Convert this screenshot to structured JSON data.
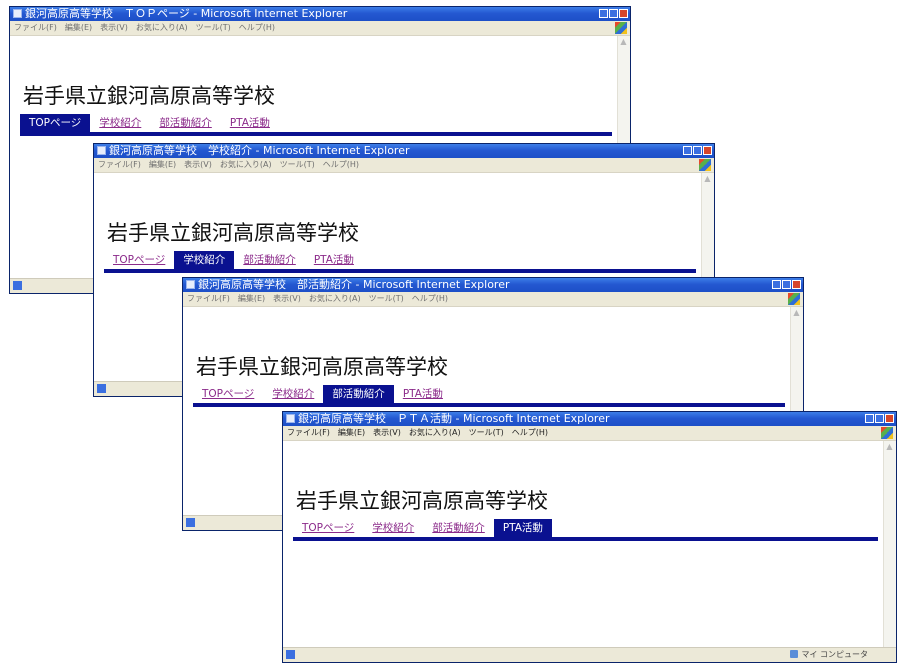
{
  "heading": "岩手県立銀河高原高等学校",
  "menu": [
    "ファイル(F)",
    "編集(E)",
    "表示(V)",
    "お気に入り(A)",
    "ツール(T)",
    "ヘルプ(H)"
  ],
  "nav": [
    "TOPページ",
    "学校紹介",
    "部活動紹介",
    "PTA活動"
  ],
  "windows": [
    {
      "title": "銀河高原高等学校　ＴＯＰページ - Microsoft Internet Explorer",
      "selected_index": 0
    },
    {
      "title": "銀河高原高等学校　学校紹介 - Microsoft Internet Explorer",
      "selected_index": 1
    },
    {
      "title": "銀河高原高等学校　部活動紹介 - Microsoft Internet Explorer",
      "selected_index": 2
    },
    {
      "title": "銀河高原高等学校　ＰＴＡ活動 - Microsoft Internet Explorer",
      "selected_index": 3
    }
  ],
  "status_zone": "マイ コンピュータ",
  "colors": {
    "nav_selected_bg": "#0a1190",
    "nav_link": "#8b2a8a",
    "titlebar": "#2458d1"
  }
}
